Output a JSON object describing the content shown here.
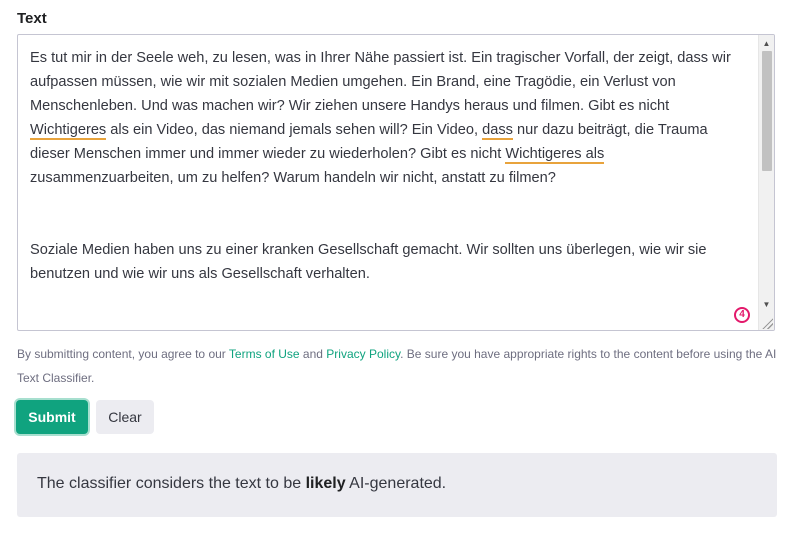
{
  "field": {
    "label": "Text"
  },
  "textarea": {
    "paragraph1": {
      "t1": "Es tut mir in der Seele weh, zu lesen, was in Ihrer Nähe passiert ist. Ein tragischer Vorfall, der zeigt, dass wir aufpassen müssen, wie wir mit sozialen Medien umgehen. Ein Brand, eine Tragödie, ein Verlust von Menschenleben. Und was machen wir? Wir ziehen unsere Handys heraus und filmen. Gibt es nicht ",
      "hl1": "Wichtigeres",
      "t2": " als ein Video, das niemand jemals sehen will? Ein Video, ",
      "hl2": "dass",
      "t3": " nur dazu beiträgt, die Trauma dieser Menschen immer und immer wieder zu wiederholen? Gibt es nicht ",
      "hl3": "Wichtigeres als",
      "t4": " zusammenzuarbeiten, um zu helfen? Warum handeln wir nicht, anstatt zu filmen?"
    },
    "paragraph2": "Soziale Medien haben uns zu einer kranken Gesellschaft gemacht. Wir sollten uns überlegen, wie wir sie benutzen und wie wir uns als Gesellschaft verhalten.",
    "issue_count": "4",
    "scroll_position": 0.0
  },
  "terms": {
    "prefix": "By submitting content, you agree to our ",
    "terms_link": "Terms of Use",
    "and": " and ",
    "privacy_link": "Privacy Policy",
    "suffix": ". Be sure you have appropriate rights to the content before using the AI Text Classifier."
  },
  "buttons": {
    "submit": "Submit",
    "clear": "Clear"
  },
  "result": {
    "prefix": "The classifier considers the text to be ",
    "verdict": "likely",
    "suffix": " AI-generated."
  },
  "colors": {
    "accent": "#10a37f",
    "highlight_underline": "#e8a33c",
    "badge": "#e3196b",
    "result_bg": "#ececf1"
  }
}
